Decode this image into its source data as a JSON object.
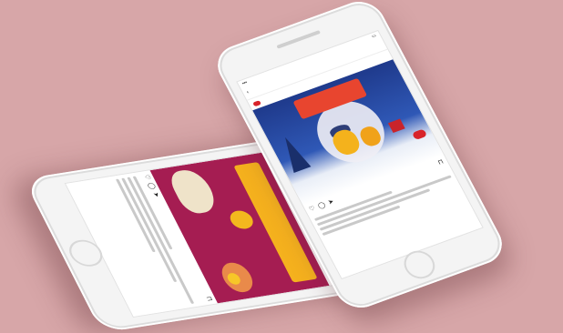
{
  "scene": {
    "background_color": "#d7a6a8",
    "phones": [
      {
        "id": "left",
        "post_theme_color": "#a51d52",
        "banner_color": "#f5b11e",
        "icons": [
          "heart-icon",
          "comment-icon",
          "send-icon",
          "bookmark-icon"
        ]
      },
      {
        "id": "right",
        "post_theme_color": "#2f58b6",
        "banner_color": "#e8452f",
        "icons": [
          "heart-icon",
          "comment-icon",
          "send-icon",
          "bookmark-icon"
        ]
      }
    ]
  }
}
